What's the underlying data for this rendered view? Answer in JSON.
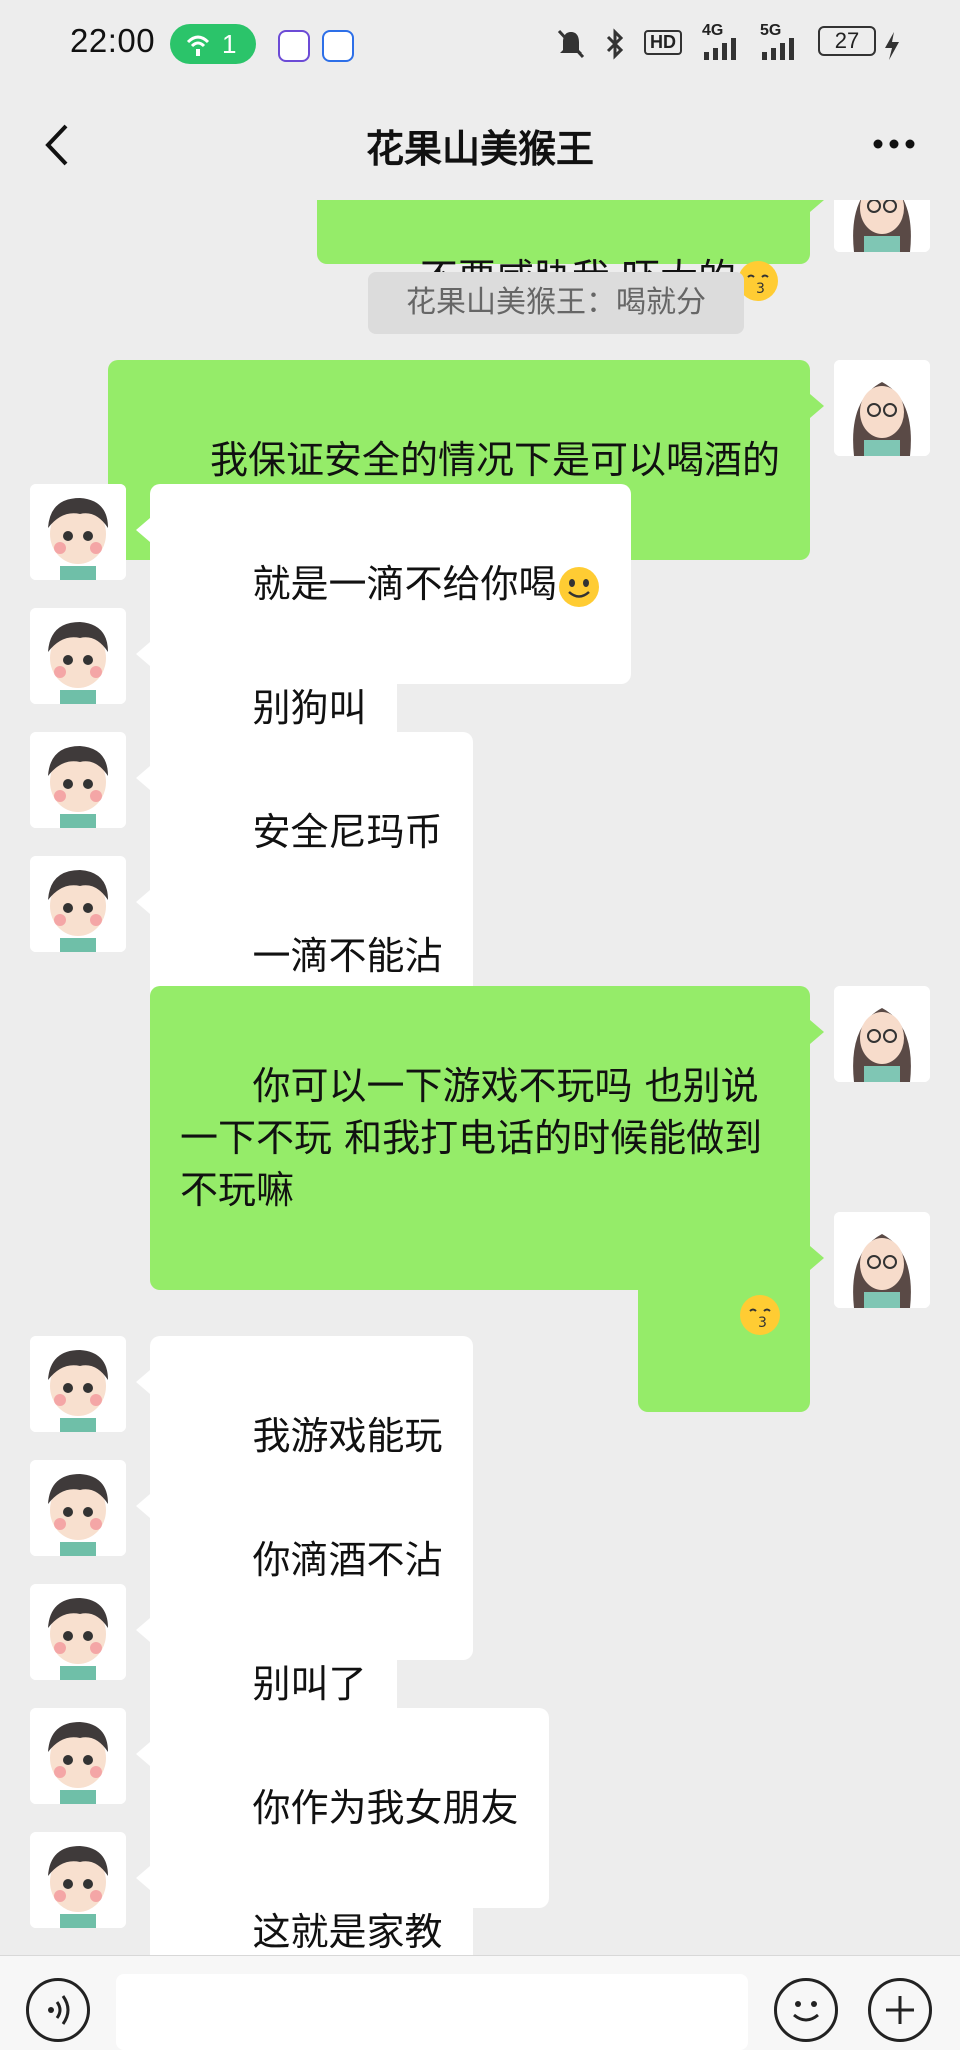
{
  "status_bar": {
    "time": "22:00",
    "hotspot_count": "1",
    "network_1": "HD",
    "network_2": "4G",
    "network_3": "5G",
    "battery": "27"
  },
  "header": {
    "title": "花果山美猴王"
  },
  "messages": [
    {
      "type": "text",
      "side": "out",
      "text": "不要威胁我 吓大的",
      "emoji": "kiss-emoji"
    },
    {
      "type": "system",
      "text": "花果山美猴王：喝就分"
    },
    {
      "type": "text",
      "side": "out",
      "text": "我保证安全的情况下是可以喝酒的"
    },
    {
      "type": "text",
      "side": "in",
      "text": "就是一滴不给你喝",
      "emoji": "smile-emoji"
    },
    {
      "type": "text",
      "side": "in",
      "text": "别狗叫"
    },
    {
      "type": "text",
      "side": "in",
      "text": "安全尼玛币"
    },
    {
      "type": "text",
      "side": "in",
      "text": "一滴不能沾"
    },
    {
      "type": "text",
      "side": "out",
      "text": "你可以一下游戏不玩吗 也别说一下不玩 和我打电话的时候能做到不玩嘛"
    },
    {
      "type": "emoji",
      "side": "out",
      "emoji": "kiss-emoji"
    },
    {
      "type": "text",
      "side": "in",
      "text": "我游戏能玩"
    },
    {
      "type": "text",
      "side": "in",
      "text": "你滴酒不沾"
    },
    {
      "type": "text",
      "side": "in",
      "text": "别叫了"
    },
    {
      "type": "text",
      "side": "in",
      "text": "你作为我女朋友"
    },
    {
      "type": "text",
      "side": "in",
      "text": "这就是家教"
    }
  ],
  "colors": {
    "background": "#ededed",
    "outgoing_bubble": "#95ec69",
    "incoming_bubble": "#ffffff",
    "hotspot": "#2bc46a"
  }
}
